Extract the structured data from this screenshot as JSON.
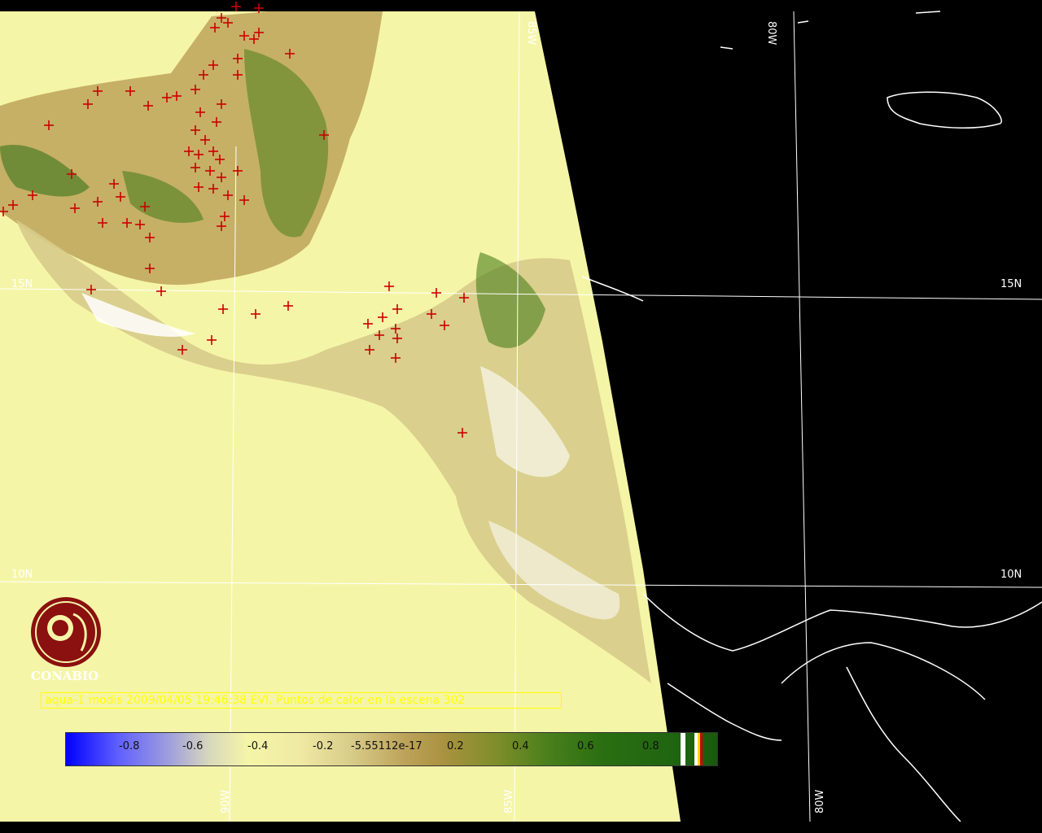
{
  "map": {
    "latitude_labels": [
      "15N",
      "10N"
    ],
    "longitude_labels": [
      "80W",
      "85W",
      "90W"
    ],
    "background_colors": {
      "land_mask": "#f5f5a8",
      "outside_scene": "#000000",
      "coastline": "#ffffff",
      "fire_marker": "#cc0000"
    },
    "markers": {
      "type": "fire-point",
      "symbol": "+"
    }
  },
  "logo": {
    "text": "CONABIO"
  },
  "caption": {
    "text": "aqua-1 modis 2009/04/05 19:46:38 EVI, Puntos de calor en la escena 302"
  },
  "colorbar": {
    "tick_labels": [
      "-0.8",
      "-0.6",
      "-0.4",
      "-0.2",
      "-5.55112e-17",
      "0.2",
      "0.4",
      "0.6",
      "0.8"
    ]
  }
}
